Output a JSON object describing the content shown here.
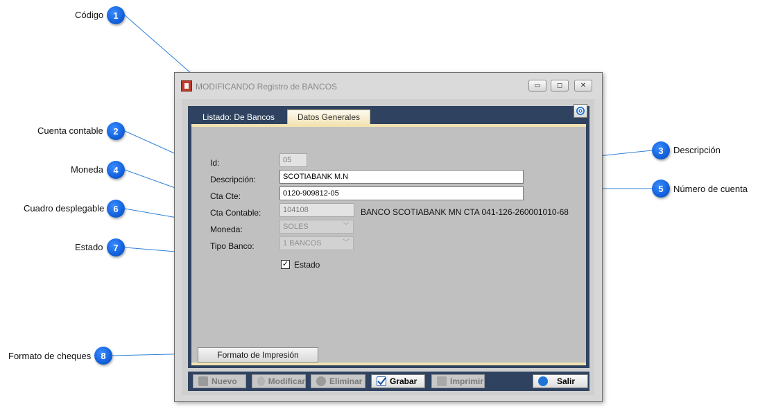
{
  "callouts": [
    {
      "n": "1",
      "label": "Código"
    },
    {
      "n": "2",
      "label": "Cuenta contable"
    },
    {
      "n": "3",
      "label": "Descripción"
    },
    {
      "n": "4",
      "label": "Moneda"
    },
    {
      "n": "5",
      "label": "Número de cuenta"
    },
    {
      "n": "6",
      "label": "Cuadro desplegable"
    },
    {
      "n": "7",
      "label": "Estado"
    },
    {
      "n": "8",
      "label": "Formato de cheques"
    }
  ],
  "window": {
    "title": "MODIFICANDO Registro de BANCOS",
    "controls": {
      "minimize": "▭",
      "maximize": "◻",
      "close": "✕"
    }
  },
  "tabs": [
    {
      "label": "Listado: De Bancos",
      "active": false
    },
    {
      "label": "Datos Generales",
      "active": true
    }
  ],
  "form": {
    "id": {
      "label": "Id:",
      "value": "05"
    },
    "descripcion": {
      "label": "Descripción:",
      "value": "SCOTIABANK M.N"
    },
    "cta_cte": {
      "label": "Cta Cte:",
      "value": "0120-909812-05"
    },
    "cta_contable": {
      "label": "Cta Contable:",
      "value": "104108",
      "description": "BANCO SCOTIABANK MN CTA 041-126-260001010-68"
    },
    "moneda": {
      "label": "Moneda:",
      "value": "SOLES"
    },
    "tipo_banco": {
      "label": "Tipo Banco:",
      "value": "1 BANCOS"
    },
    "estado": {
      "label": "Estado",
      "checked": true
    },
    "formato_button": "Formato de Impresión"
  },
  "toolbar": {
    "nuevo": "Nuevo",
    "modificar": "Modificar",
    "eliminar": "Eliminar",
    "grabar": "Grabar",
    "imprimir": "Imprimir",
    "salir": "Salir"
  },
  "colors": {
    "badge": "#1565e0",
    "frame": "#2f4360",
    "tab_active": "#f4e4b8",
    "callout_line": "#2f7fd6"
  }
}
